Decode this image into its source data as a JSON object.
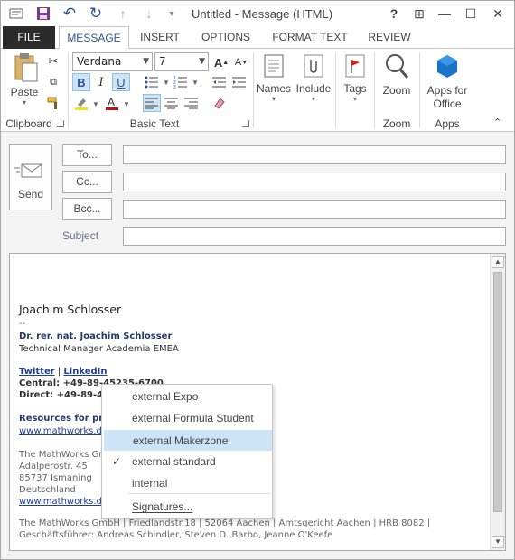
{
  "window": {
    "title": "Untitled - Message (HTML)"
  },
  "quick_access": {
    "save_icon": "save-icon",
    "undo_icon": "undo-icon",
    "redo_icon": "redo-icon",
    "up_icon": "up-arrow-icon",
    "down_icon": "down-arrow-icon"
  },
  "window_controls": {
    "help": "?",
    "restore_ribbon": "⊞",
    "minimize": "—",
    "maximize": "☐",
    "close": "✕"
  },
  "tabs": [
    "FILE",
    "MESSAGE",
    "INSERT",
    "OPTIONS",
    "FORMAT TEXT",
    "REVIEW"
  ],
  "ribbon": {
    "clipboard": {
      "paste": "Paste",
      "label": "Clipboard"
    },
    "basic_text": {
      "font": "Verdana",
      "size": "7",
      "grow": "A",
      "shrink": "A",
      "bold": "B",
      "italic": "I",
      "underline": "U",
      "label": "Basic Text"
    },
    "names": {
      "label": "Names"
    },
    "include": {
      "label": "Include"
    },
    "tags": {
      "label": "Tags"
    },
    "zoom": {
      "button": "Zoom",
      "label": "Zoom"
    },
    "apps": {
      "line1": "Apps for",
      "line2": "Office",
      "label": "Apps"
    }
  },
  "header": {
    "send": "Send",
    "to": "To...",
    "cc": "Cc...",
    "bcc": "Bcc...",
    "subject": "Subject"
  },
  "signature": {
    "name": "Joachim Schlosser",
    "dashes": "--",
    "fullname": "Dr. rer. nat. Joachim Schlosser",
    "position": "Technical Manager Academia EMEA",
    "twitter": "Twitter",
    "pipe": "|",
    "linkedin": "LinkedIn",
    "central": "Central: +49-89-45235-6700",
    "direct": "Direct: +49-89-452",
    "resources": "Resources for prof",
    "url1": "www.mathworks.de",
    "company": "The MathWorks Gm",
    "street": "Adalperostr. 45",
    "city": "85737 Ismaning",
    "country": "Deutschland",
    "url2": "www.mathworks.de",
    "footer1": "The MathWorks GmbH | Friedlandstr.18 | 52064 Aachen | Amtsgericht Aachen | HRB 8082 |",
    "footer2": "Geschäftsführer: Andreas Schindler, Steven D. Barbo, Jeanne O'Keefe"
  },
  "menu": {
    "items": [
      {
        "label": "external Expo",
        "checked": false,
        "highlighted": false
      },
      {
        "label": "external Formula Student",
        "checked": false,
        "highlighted": false
      },
      {
        "label": "external Makerzone",
        "checked": false,
        "highlighted": true
      },
      {
        "label": "external standard",
        "checked": true,
        "highlighted": false
      },
      {
        "label": "internal",
        "checked": false,
        "highlighted": false
      }
    ],
    "signatures": "Signatures...",
    "check_mark": "✓"
  },
  "colors": {
    "accent": "#2b579a",
    "highlight": "#cce4f7",
    "file_tab": "#2b2b2b",
    "link": "#1f3f9a"
  }
}
